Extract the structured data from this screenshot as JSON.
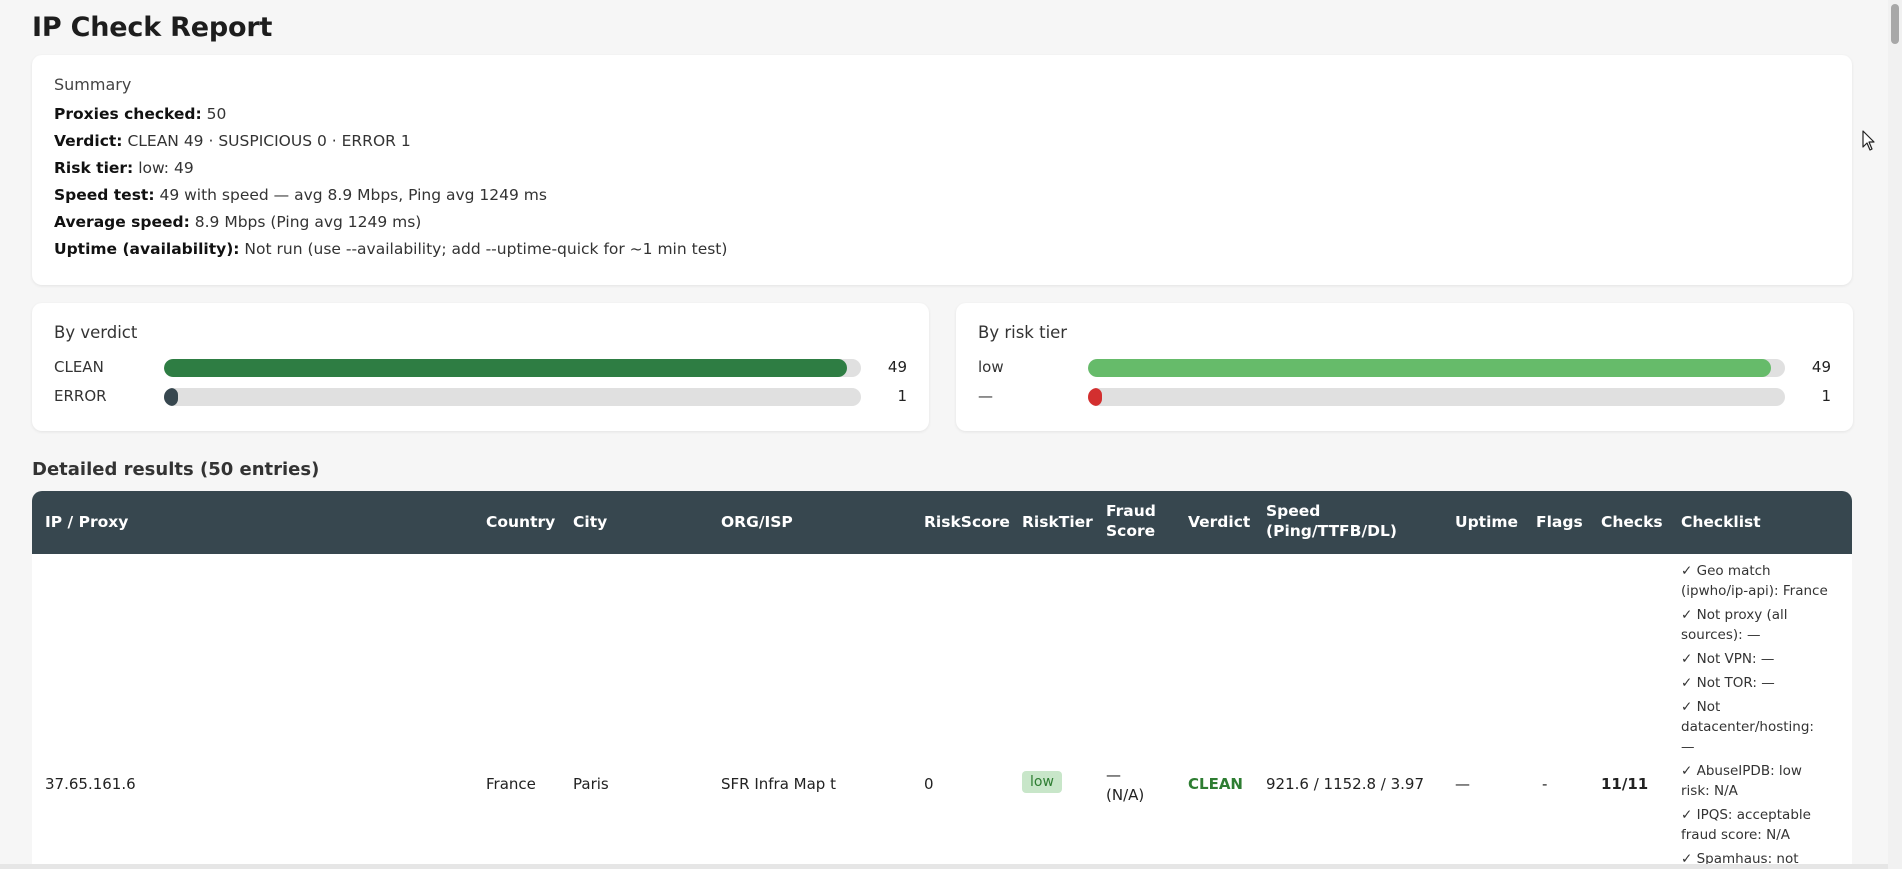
{
  "page": {
    "title": "IP Check Report"
  },
  "summary": {
    "heading": "Summary",
    "rows": [
      {
        "label": "Proxies checked:",
        "value": " 50"
      },
      {
        "label": "Verdict:",
        "value": " CLEAN 49 · SUSPICIOUS 0 · ERROR 1"
      },
      {
        "label": "Risk tier:",
        "value": " low: 49"
      },
      {
        "label": "Speed test:",
        "value": " 49 with speed — avg 8.9 Mbps, Ping avg 1249 ms"
      },
      {
        "label": "Average speed:",
        "value": " 8.9 Mbps (Ping avg 1249 ms)"
      },
      {
        "label": "Uptime (availability):",
        "value": " Not run (use --availability; add --uptime-quick for ~1 min test)"
      }
    ]
  },
  "by_verdict": {
    "heading": "By verdict",
    "rows": [
      {
        "label": "CLEAN",
        "count": "49",
        "fraction": 0.98,
        "color": "#2e7d43"
      },
      {
        "label": "ERROR",
        "count": "1",
        "fraction": 0.02,
        "color": "#37474f"
      }
    ]
  },
  "by_risk": {
    "heading": "By risk tier",
    "rows": [
      {
        "label": "low",
        "count": "49",
        "fraction": 0.98,
        "color": "#66bb6a"
      },
      {
        "label": "—",
        "count": "1",
        "fraction": 0.02,
        "color": "#d32f2f"
      }
    ]
  },
  "details": {
    "title": "Detailed results (50 entries)",
    "columns": {
      "ip": "IP / Proxy",
      "country": "Country",
      "city": "City",
      "org": "ORG/ISP",
      "riskscore": "RiskScore",
      "risktier": "RiskTier",
      "fraud1": "Fraud",
      "fraud2": "Score",
      "verdict": "Verdict",
      "speed1": "Speed",
      "speed2": "(Ping/TTFB/DL)",
      "uptime": "Uptime",
      "flags": "Flags",
      "checks": "Checks",
      "checklist": "Checklist"
    },
    "row": {
      "ip": "37.65.161.6",
      "country": "France",
      "city": "Paris",
      "org": "SFR Infra Map t",
      "riskscore": "0",
      "risktier": "low",
      "fraud1": "—",
      "fraud2": "(N/A)",
      "verdict": "CLEAN",
      "speed": "921.6 / 1152.8 / 3.97",
      "uptime": "—",
      "flags": "-",
      "checks": "11/11",
      "checklist": [
        "✓ Geo match (ipwho/ip-api): France",
        "✓ Not proxy (all sources): —",
        "✓ Not VPN: —",
        "✓ Not TOR: —",
        "✓ Not datacenter/hosting: —",
        "✓ AbuseIPDB: low risk: N/A",
        "✓ IPQS: acceptable fraud score: N/A",
        "✓ Spamhaus: not listed: —"
      ]
    }
  },
  "colors": {
    "header_bg": "#37474f",
    "clean_text": "#2e7d32",
    "pill_bg": "#c8e6c9"
  }
}
